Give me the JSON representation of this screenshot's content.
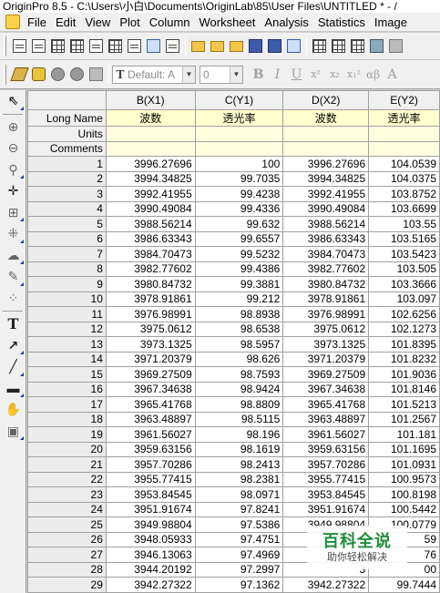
{
  "window": {
    "title": "OriginPro 8.5 - C:\\Users\\小白\\Documents\\OriginLab\\85\\User Files\\UNTITLED * - /"
  },
  "menu": [
    "File",
    "Edit",
    "View",
    "Plot",
    "Column",
    "Worksheet",
    "Analysis",
    "Statistics",
    "Image"
  ],
  "format_toolbar": {
    "font_value": "Default: A",
    "size_value": "0",
    "buttons": [
      "B",
      "I",
      "U",
      "x²",
      "x₂",
      "x₁²",
      "αβ",
      "A"
    ]
  },
  "worksheet": {
    "columns": [
      "B(X1)",
      "C(Y1)",
      "D(X2)",
      "E(Y2)"
    ],
    "long_name_label": "Long Name",
    "units_label": "Units",
    "comments_label": "Comments",
    "long_names": [
      "波数",
      "透光率",
      "波数",
      "透光率"
    ],
    "rows": [
      [
        "1",
        "3996.27696",
        "100",
        "3996.27696",
        "104.0539"
      ],
      [
        "2",
        "3994.34825",
        "99.7035",
        "3994.34825",
        "104.0375"
      ],
      [
        "3",
        "3992.41955",
        "99.4238",
        "3992.41955",
        "103.8752"
      ],
      [
        "4",
        "3990.49084",
        "99.4336",
        "3990.49084",
        "103.6699"
      ],
      [
        "5",
        "3988.56214",
        "99.632",
        "3988.56214",
        "103.55"
      ],
      [
        "6",
        "3986.63343",
        "99.6557",
        "3986.63343",
        "103.5165"
      ],
      [
        "7",
        "3984.70473",
        "99.5232",
        "3984.70473",
        "103.5423"
      ],
      [
        "8",
        "3982.77602",
        "99.4386",
        "3982.77602",
        "103.505"
      ],
      [
        "9",
        "3980.84732",
        "99.3881",
        "3980.84732",
        "103.3666"
      ],
      [
        "10",
        "3978.91861",
        "99.212",
        "3978.91861",
        "103.097"
      ],
      [
        "11",
        "3976.98991",
        "98.8938",
        "3976.98991",
        "102.6256"
      ],
      [
        "12",
        "3975.0612",
        "98.6538",
        "3975.0612",
        "102.1273"
      ],
      [
        "13",
        "3973.1325",
        "98.5957",
        "3973.1325",
        "101.8395"
      ],
      [
        "14",
        "3971.20379",
        "98.626",
        "3971.20379",
        "101.8232"
      ],
      [
        "15",
        "3969.27509",
        "98.7593",
        "3969.27509",
        "101.9036"
      ],
      [
        "16",
        "3967.34638",
        "98.9424",
        "3967.34638",
        "101.8146"
      ],
      [
        "17",
        "3965.41768",
        "98.8809",
        "3965.41768",
        "101.5213"
      ],
      [
        "18",
        "3963.48897",
        "98.5115",
        "3963.48897",
        "101.2567"
      ],
      [
        "19",
        "3961.56027",
        "98.196",
        "3961.56027",
        "101.181"
      ],
      [
        "20",
        "3959.63156",
        "98.1619",
        "3959.63156",
        "101.1695"
      ],
      [
        "21",
        "3957.70286",
        "98.2413",
        "3957.70286",
        "101.0931"
      ],
      [
        "22",
        "3955.77415",
        "98.2381",
        "3955.77415",
        "100.9573"
      ],
      [
        "23",
        "3953.84545",
        "98.0971",
        "3953.84545",
        "100.8198"
      ],
      [
        "24",
        "3951.91674",
        "97.8241",
        "3951.91674",
        "100.5442"
      ],
      [
        "25",
        "3949.98804",
        "97.5386",
        "3949.98804",
        "100.0779"
      ],
      [
        "26",
        "3948.05933",
        "97.4751",
        "3",
        "59"
      ],
      [
        "27",
        "3946.13063",
        "97.4969",
        "3",
        "76"
      ],
      [
        "28",
        "3944.20192",
        "97.2997",
        "3",
        "00"
      ],
      [
        "29",
        "3942.27322",
        "97.1362",
        "3942.27322",
        "99.7444"
      ],
      [
        "30",
        "3940.34451",
        "97.2764",
        "3940.34451",
        "99.7208"
      ]
    ]
  },
  "watermark": {
    "title": "百科全说",
    "subtitle": "助你轻松解决"
  }
}
